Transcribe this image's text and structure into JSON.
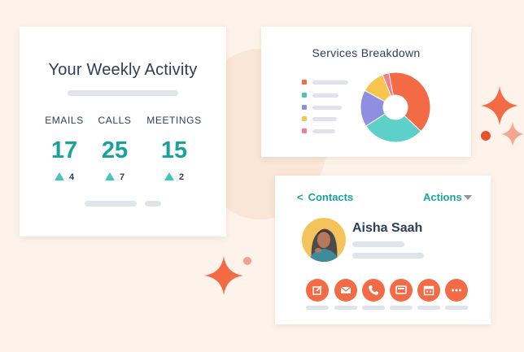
{
  "colors": {
    "background": "#fdf3ea",
    "accent_teal": "#1aa39c",
    "accent_orange": "#f26b45",
    "text_dark": "#2e3f55",
    "placeholder": "#dfe3ea"
  },
  "weekly_activity": {
    "title": "Your Weekly Activity",
    "stats": [
      {
        "label": "EMAILS",
        "value": "17",
        "change": "4",
        "trend_icon": "triangle-up-icon"
      },
      {
        "label": "CALLS",
        "value": "25",
        "change": "7",
        "trend_icon": "triangle-up-icon"
      },
      {
        "label": "MEETINGS",
        "value": "15",
        "change": "2",
        "trend_icon": "triangle-up-icon"
      }
    ]
  },
  "services_breakdown": {
    "title": "Services Breakdown",
    "legend_colors": [
      "#f26b45",
      "#46c4bd",
      "#8e8fe0",
      "#f7c54e",
      "#f07e8c"
    ]
  },
  "chart_data": {
    "type": "pie",
    "title": "Services Breakdown",
    "values": [
      40,
      29,
      17,
      11,
      3
    ],
    "colors": [
      "#f26b45",
      "#5dd0ca",
      "#8e8fe0",
      "#f7c54e",
      "#f07e8c"
    ],
    "donut": true
  },
  "contact": {
    "back_label": "Contacts",
    "back_icon": "chevron-left-icon",
    "actions_label": "Actions",
    "actions_icon": "chevron-down-icon",
    "name": "Aisha Saah",
    "action_icons": [
      "edit-icon",
      "email-icon",
      "phone-icon",
      "screen-icon",
      "calendar-icon",
      "more-icon"
    ]
  }
}
